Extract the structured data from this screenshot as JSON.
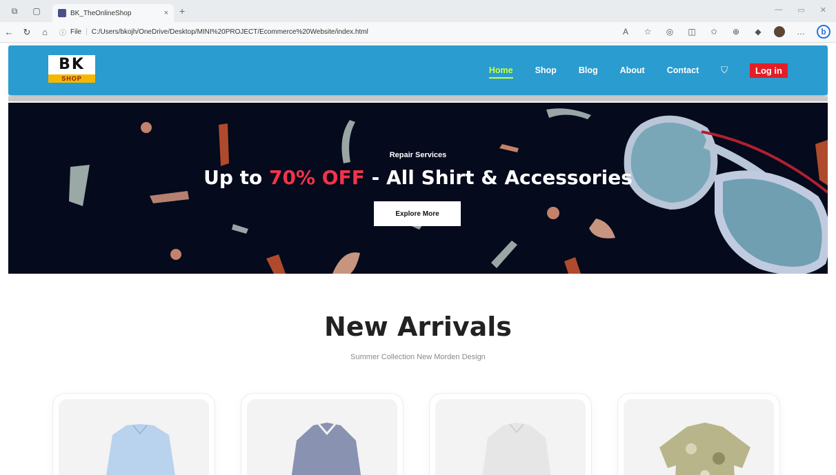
{
  "browser": {
    "tab_title": "BK_TheOnlineShop",
    "url_prefix": "File",
    "url": "C:/Users/bkojh/OneDrive/Desktop/MINI%20PROJECT/Ecommerce%20Website/index.html"
  },
  "header": {
    "logo_top": "BK",
    "logo_bottom": "SHOP",
    "nav": {
      "home": "Home",
      "shop": "Shop",
      "blog": "Blog",
      "about": "About",
      "contact": "Contact"
    },
    "login": "Log in"
  },
  "hero": {
    "subtitle": "Repair Services",
    "headline_pre": "Up to ",
    "headline_highlight": "70% OFF",
    "headline_post": " - All Shirt & Accessories",
    "cta": "Explore More"
  },
  "section": {
    "title": "New Arrivals",
    "subtitle": "Summer Collection New Morden Design"
  },
  "colors": {
    "header_bg": "#2a9ccf",
    "nav_active": "#c9ff3a",
    "login_bg": "#e41e26",
    "hero_bg": "#050a1c",
    "hero_highlight": "#f2334a"
  },
  "products": [
    {
      "name": "light-blue-shirt",
      "color": "#b9d2ee"
    },
    {
      "name": "striped-shirt",
      "color": "#8a92b2"
    },
    {
      "name": "white-shirt",
      "color": "#ececec"
    },
    {
      "name": "floral-shirt",
      "color": "#b8b58a"
    }
  ]
}
